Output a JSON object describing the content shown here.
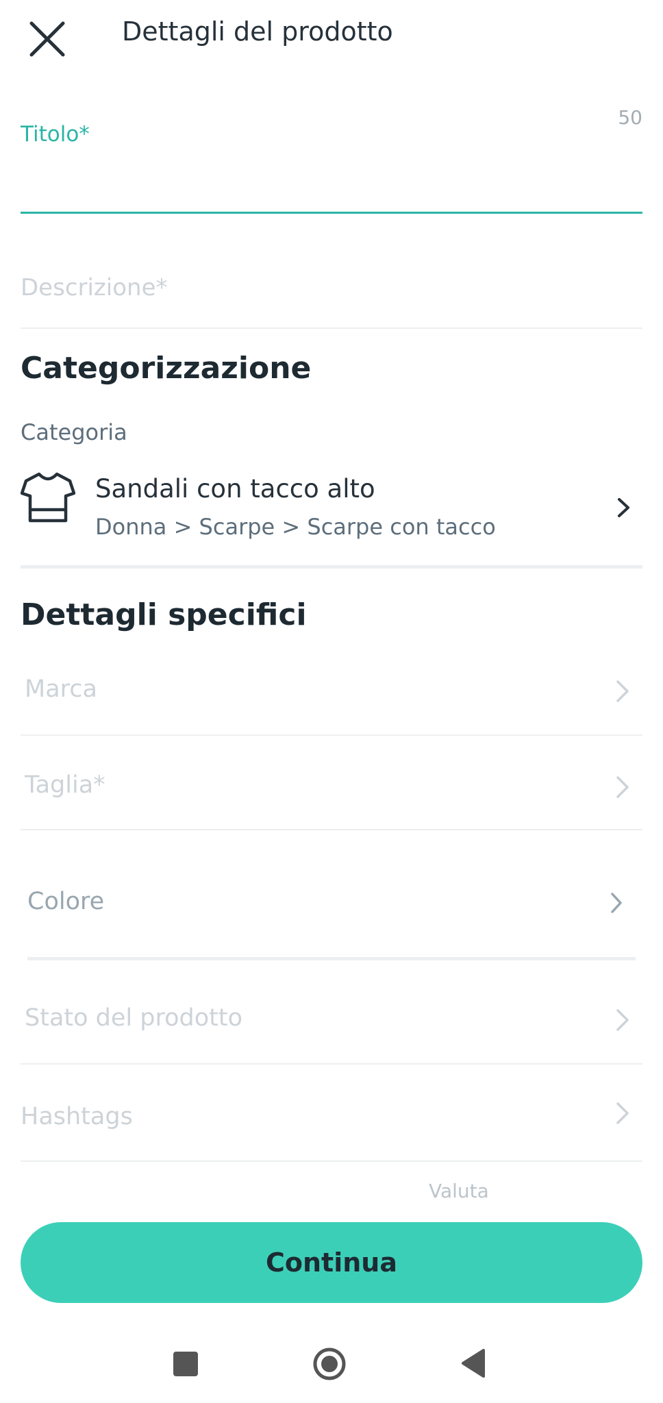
{
  "header": {
    "title": "Dettagli del prodotto"
  },
  "title_field": {
    "label": "Titolo*",
    "char_count": "50",
    "value": ""
  },
  "description_field": {
    "placeholder": "Descrizione*"
  },
  "categorization": {
    "heading": "Categorizzazione",
    "label": "Categoria",
    "category_name": "Sandali con tacco alto",
    "category_path": "Donna > Scarpe > Scarpe con tacco"
  },
  "details": {
    "heading": "Dettagli specifici",
    "brand_label": "Marca",
    "size_label": "Taglia*",
    "color_label": "Colore",
    "condition_label": "Stato del prodotto",
    "hashtags_label": "Hashtags"
  },
  "price": {
    "currency_label": "Valuta"
  },
  "actions": {
    "continue_label": "Continua"
  },
  "colors": {
    "accent": "#2ab5a6",
    "button": "#3ccfb8",
    "text": "#26313a"
  }
}
